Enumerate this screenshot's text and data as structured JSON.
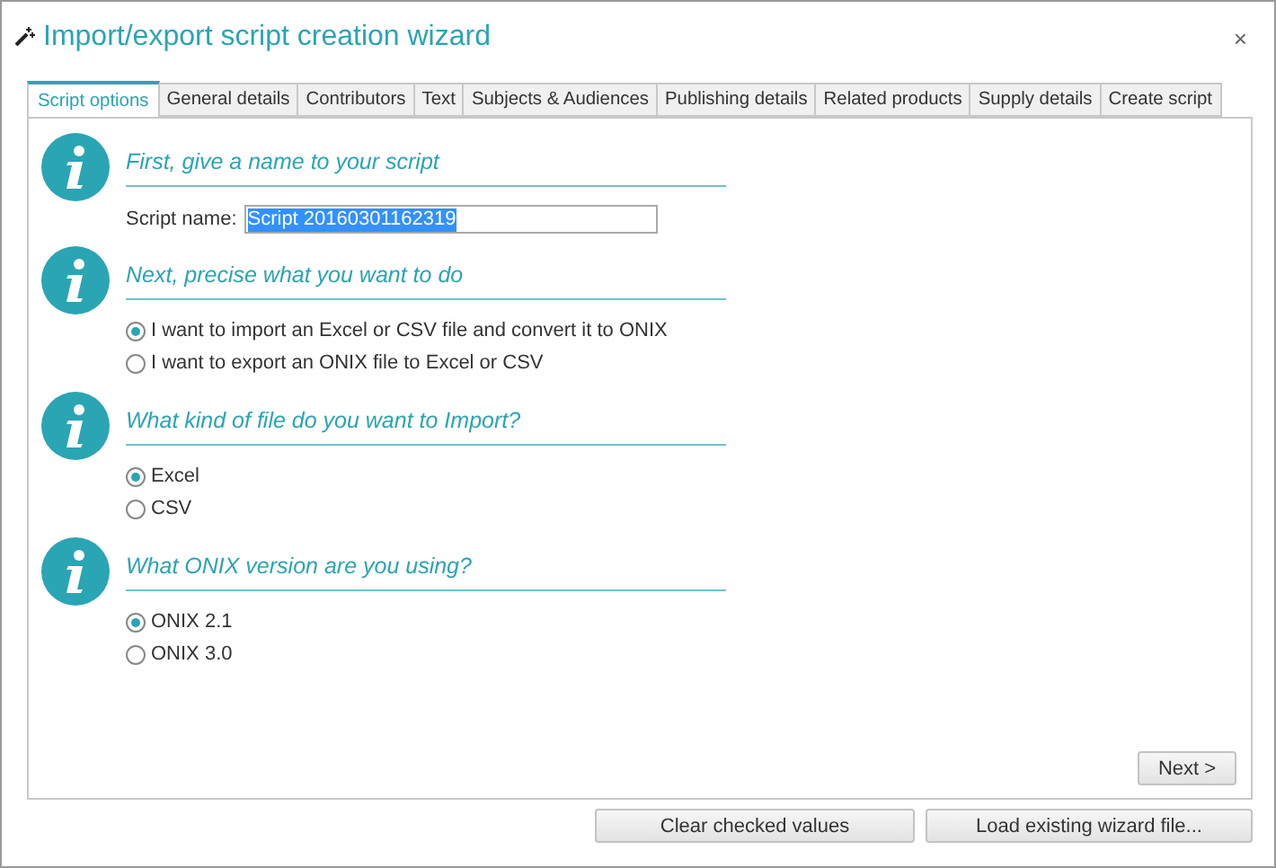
{
  "window": {
    "title": "Import/export script creation wizard",
    "close": "×"
  },
  "tabs": [
    {
      "label": "Script options",
      "selected": true
    },
    {
      "label": "General details",
      "selected": false
    },
    {
      "label": "Contributors",
      "selected": false
    },
    {
      "label": "Text",
      "selected": false
    },
    {
      "label": "Subjects & Audiences",
      "selected": false
    },
    {
      "label": "Publishing details",
      "selected": false
    },
    {
      "label": "Related products",
      "selected": false
    },
    {
      "label": "Supply details",
      "selected": false
    },
    {
      "label": "Create script",
      "selected": false
    }
  ],
  "sections": [
    {
      "kind": "name_field",
      "heading": "First, give a name to your script",
      "label": "Script name:",
      "value": "Script 20160301162319"
    },
    {
      "kind": "radio",
      "heading": "Next, precise what you want to do",
      "options": [
        {
          "label": "I want to import an Excel or CSV file and convert it to ONIX",
          "selected": true
        },
        {
          "label": "I want to export an ONIX file to Excel or CSV",
          "selected": false
        }
      ]
    },
    {
      "kind": "radio",
      "heading": "What kind of file do you want to Import?",
      "options": [
        {
          "label": "Excel",
          "selected": true
        },
        {
          "label": "CSV",
          "selected": false
        }
      ]
    },
    {
      "kind": "radio",
      "heading": "What ONIX version are you using?",
      "options": [
        {
          "label": "ONIX 2.1",
          "selected": true
        },
        {
          "label": "ONIX 3.0",
          "selected": false
        }
      ]
    }
  ],
  "next_button": "Next >",
  "footer_buttons": [
    "Clear checked values",
    "Load existing wizard file..."
  ]
}
